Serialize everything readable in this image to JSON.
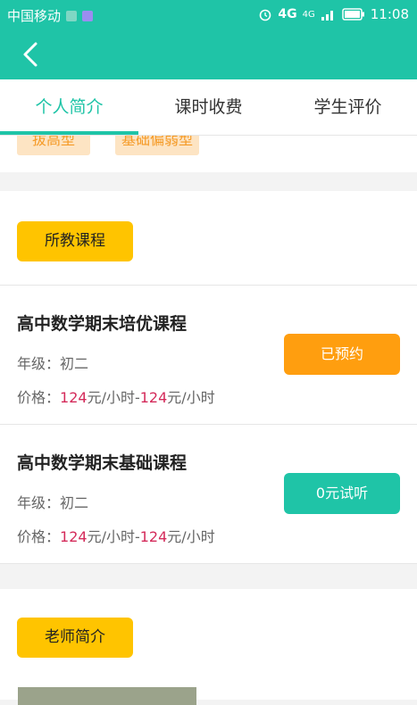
{
  "status_bar": {
    "carrier": "中国移动",
    "network": "4G",
    "network2": "4G",
    "time": "11:08",
    "icons": [
      "image-icon",
      "gallery-icon",
      "alarm-icon",
      "signal-icon",
      "battery-icon"
    ]
  },
  "header": {
    "back_icon": "chevron-left-icon"
  },
  "tabs": [
    {
      "label": "个人简介",
      "active": true
    },
    {
      "label": "课时收费",
      "active": false
    },
    {
      "label": "学生评价",
      "active": false
    }
  ],
  "tags": [
    "拔高型",
    "基础偏弱型"
  ],
  "courses_section": {
    "label": "所教课程"
  },
  "courses": [
    {
      "title": "高中数学期末培优课程",
      "grade_label": "年级：",
      "grade": "初二",
      "price_label": "价格：",
      "price_min": "124",
      "price_max": "124",
      "unit": "元/小时",
      "sep": "-",
      "button": "已预约",
      "button_color": "#ff9e0f"
    },
    {
      "title": "高中数学期末基础课程",
      "grade_label": "年级：",
      "grade": "初二",
      "price_label": "价格：",
      "price_min": "124",
      "price_max": "124",
      "unit": "元/小时",
      "sep": "-",
      "button": "0元试听",
      "button_color": "#1fc4a7"
    }
  ],
  "teacher_section": {
    "label": "老师简介"
  },
  "colors": {
    "brand": "#1fc4a7",
    "pill": "#ffc400",
    "price": "#d42a5a"
  }
}
